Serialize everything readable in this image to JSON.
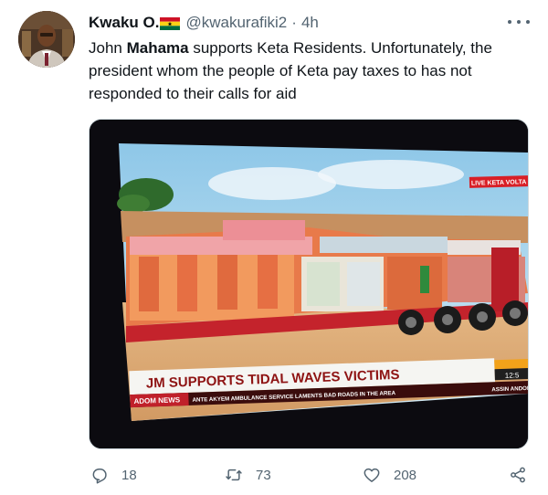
{
  "tweet": {
    "author": {
      "name": "Kwaku O.",
      "flag_icon": "ghana-flag-icon",
      "handle": "@kwakurafiki2",
      "separator": "·",
      "time": "4h"
    },
    "text": {
      "part1": "John ",
      "bold": "Mahama",
      "part2": " supports Keta Residents. Unfortunately, the president whom the people of Keta pay taxes to has not responded to their calls for aid"
    },
    "media": {
      "live_tag": "LIVE  KETA VOLTA",
      "headline": "JM SUPPORTS TIDAL WAVES VICTIMS",
      "channel": "ADOM NEWS",
      "ticker": "ANTE AKYEM AMBULANCE SERVICE LAMENTS BAD ROADS IN THE AREA",
      "ticker2": "ASSIN ANDOH",
      "clock": "12:5"
    },
    "actions": {
      "replies": "18",
      "retweets": "73",
      "likes": "208"
    },
    "colors": {
      "text": "#0f1419",
      "secondary": "#536471",
      "flag_red": "#ce1126",
      "flag_yellow": "#fcd116",
      "flag_green": "#006b3f"
    }
  }
}
